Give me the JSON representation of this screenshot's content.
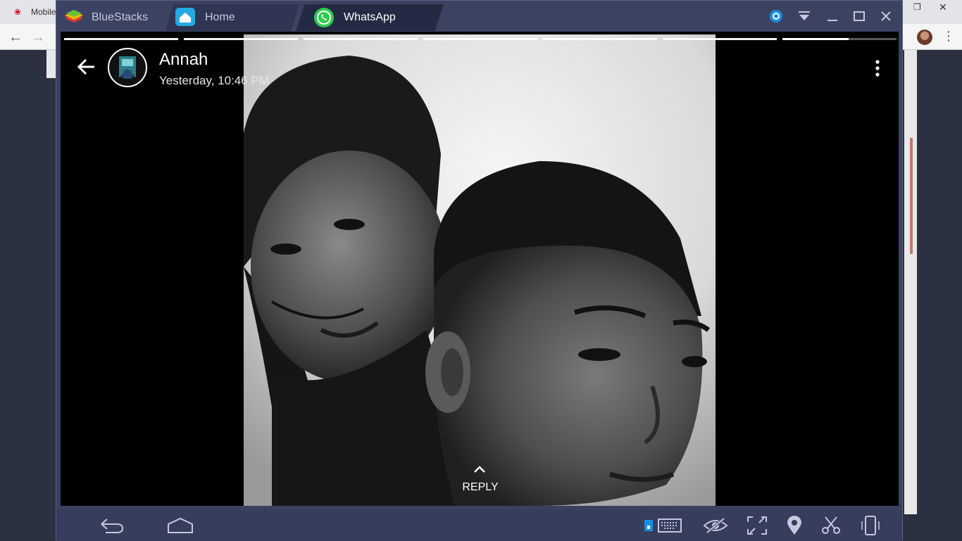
{
  "chrome": {
    "tab_title": "Mobile"
  },
  "bluestacks": {
    "tabs": [
      {
        "label": "BlueStacks"
      },
      {
        "label": "Home"
      },
      {
        "label": "WhatsApp"
      }
    ]
  },
  "status": {
    "contact_name": "Annah",
    "timestamp": "Yesterday, 10:46 PM",
    "reply_label": "REPLY",
    "segments_total": 7,
    "active_segment": 7,
    "active_segment_progress": 0.58
  },
  "icons": {
    "back": "back-arrow-icon",
    "more": "more-vert-icon",
    "reply": "chevron-up-icon"
  },
  "colors": {
    "bluestacks_frame": "#3b4262",
    "whatsapp_green": "#2ecc50",
    "status_bg": "#000000"
  }
}
